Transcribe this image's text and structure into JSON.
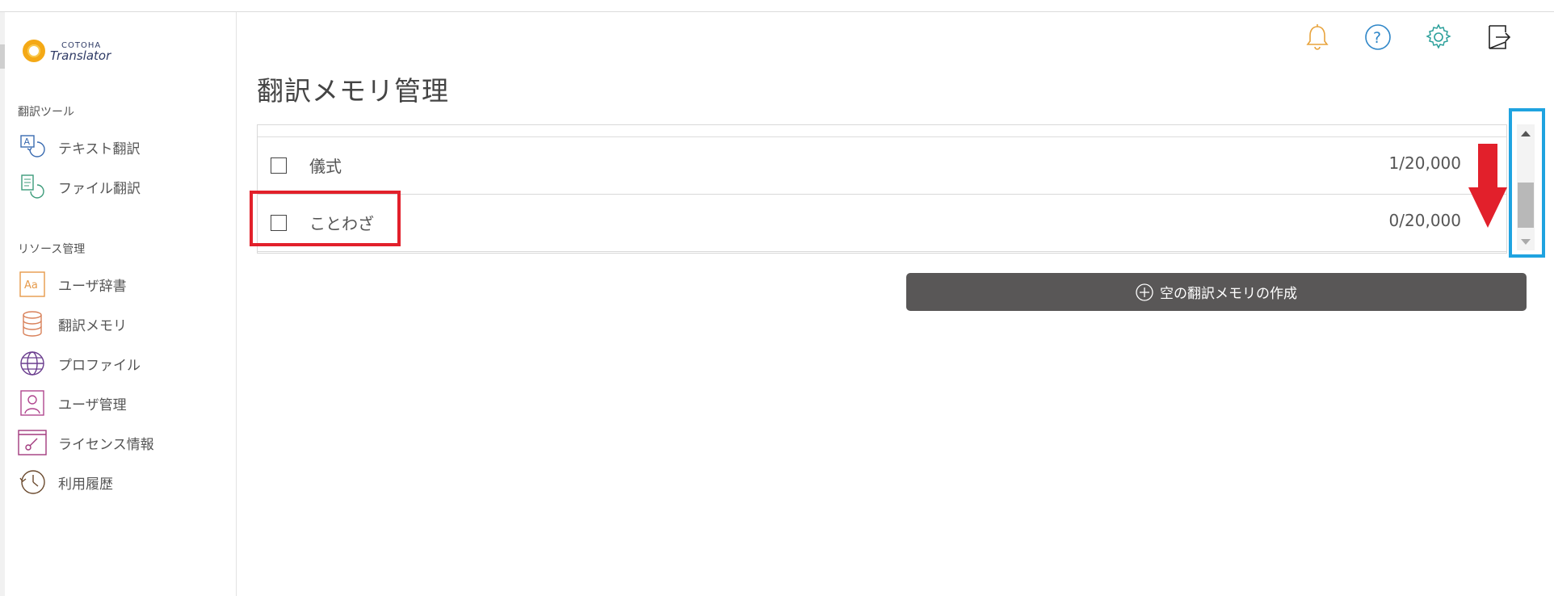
{
  "app": {
    "logo_line1": "COTOHA",
    "logo_line2": "Translator",
    "brand_color": "#f4a916"
  },
  "sidebar": {
    "sections": [
      {
        "label": "翻訳ツール"
      },
      {
        "label": "リソース管理"
      }
    ],
    "items": [
      {
        "label": "テキスト翻訳",
        "icon": "text-translate-icon"
      },
      {
        "label": "ファイル翻訳",
        "icon": "file-translate-icon"
      },
      {
        "label": "ユーザ辞書",
        "icon": "user-dictionary-icon"
      },
      {
        "label": "翻訳メモリ",
        "icon": "database-icon"
      },
      {
        "label": "プロファイル",
        "icon": "globe-icon"
      },
      {
        "label": "ユーザ管理",
        "icon": "user-icon"
      },
      {
        "label": "ライセンス情報",
        "icon": "license-icon"
      },
      {
        "label": "利用履歴",
        "icon": "history-icon"
      }
    ]
  },
  "header": {
    "title": "翻訳メモリ管理",
    "icons": [
      "bell-icon",
      "help-icon",
      "gear-icon",
      "logout-icon"
    ]
  },
  "table": {
    "rows": [
      {
        "name": "儀式",
        "count": "1/20,000"
      },
      {
        "name": "ことわざ",
        "count": "0/20,000"
      }
    ]
  },
  "actions": {
    "create_label": "空の翻訳メモリの作成"
  },
  "colors": {
    "annotation_red": "#e2202b",
    "annotation_blue": "#1fa3e0",
    "button_bg": "#595757"
  }
}
